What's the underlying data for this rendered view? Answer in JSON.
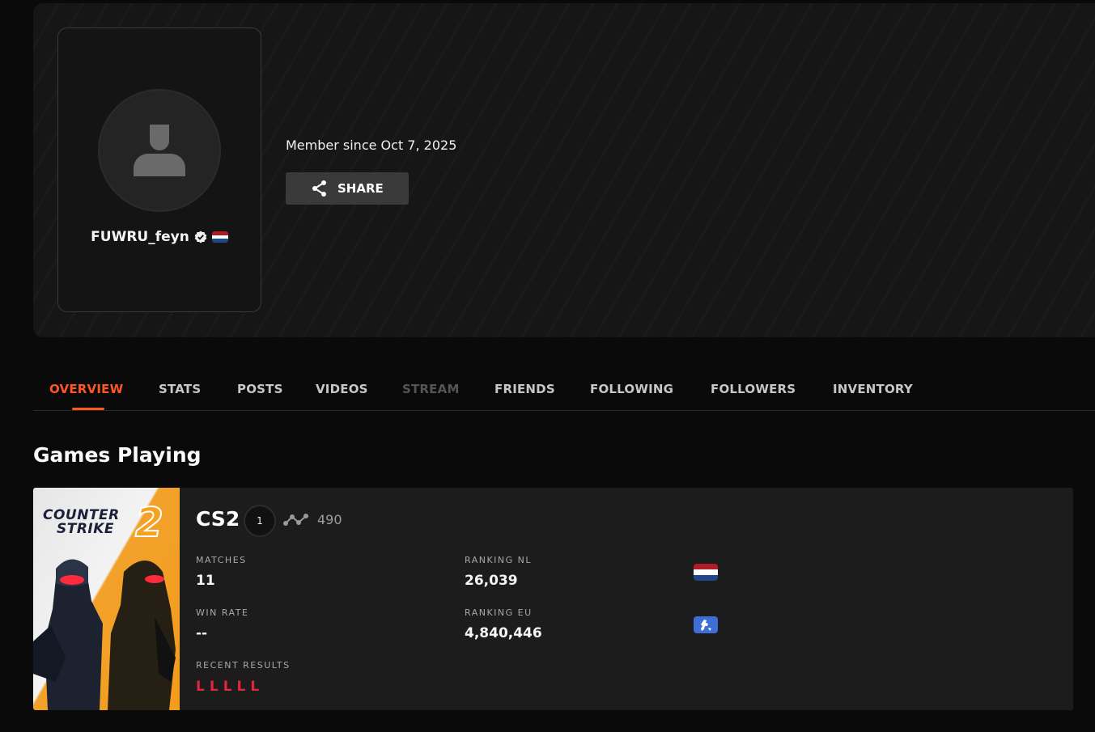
{
  "profile": {
    "username": "FUWRU_feyn",
    "member_since": "Member since Oct 7, 2025",
    "share_label": "SHARE",
    "avatar_icon": "user-silhouette-icon",
    "verified_icon": "verified-badge-icon",
    "country_flag": "Netherlands"
  },
  "tabs": [
    {
      "label": "OVERVIEW",
      "state": "active"
    },
    {
      "label": "STATS",
      "state": "normal"
    },
    {
      "label": "POSTS",
      "state": "normal"
    },
    {
      "label": "VIDEOS",
      "state": "normal"
    },
    {
      "label": "STREAM",
      "state": "disabled"
    },
    {
      "label": "FRIENDS",
      "state": "normal"
    },
    {
      "label": "FOLLOWING",
      "state": "normal"
    },
    {
      "label": "FOLLOWERS",
      "state": "normal"
    },
    {
      "label": "INVENTORY",
      "state": "normal"
    }
  ],
  "games_section": {
    "title": "Games Playing"
  },
  "game": {
    "name": "CS2",
    "cover_logo_line1": "COUNTER",
    "cover_logo_line2": "STRIKE",
    "cover_logo_number": "2",
    "level": "1",
    "elo": "490",
    "stats": {
      "matches_label": "MATCHES",
      "matches_value": "11",
      "win_rate_label": "WIN RATE",
      "win_rate_value": "--",
      "recent_results_label": "RECENT RESULTS",
      "recent_results": [
        "L",
        "L",
        "L",
        "L",
        "L"
      ],
      "ranking_nl_label": "RANKING NL",
      "ranking_nl_value": "26,039",
      "ranking_eu_label": "RANKING EU",
      "ranking_eu_value": "4,840,446"
    }
  },
  "colors": {
    "accent": "#ff5722",
    "loss": "#e0263d",
    "card_bg": "#1c1c1c",
    "page_bg": "#0a0a0a"
  }
}
